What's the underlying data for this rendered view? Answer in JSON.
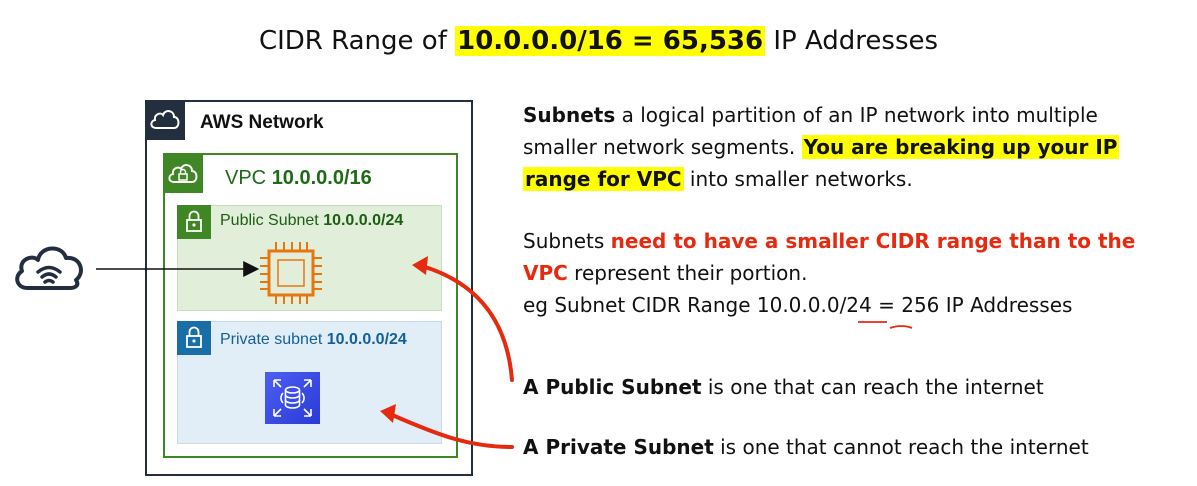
{
  "title": {
    "prefix": "CIDR Range of ",
    "highlight": "10.0.0.0/16 = 65,536",
    "suffix": " IP Addresses"
  },
  "diagram": {
    "aws_network_label": "AWS Network",
    "vpc_label_prefix": "VPC ",
    "vpc_cidr": "10.0.0.0/16",
    "public_subnet_label": "Public Subnet ",
    "public_subnet_cidr": "10.0.0.0/24",
    "private_subnet_label": "Private subnet ",
    "private_subnet_cidr": "10.0.0.0/24",
    "icons": [
      "internet-cloud-icon",
      "aws-cloud-icon",
      "vpc-cloud-lock-icon",
      "public-subnet-lock-icon",
      "ec2-chip-icon",
      "private-subnet-lock-icon",
      "rds-database-icon"
    ]
  },
  "description": {
    "p1_term": "Subnets",
    "p1_line1_rest": " a logical partition of an IP network into multiple",
    "p1_line2_plain": "smaller network segments. ",
    "p1_line2_highlight": "You are breaking up your IP",
    "p1_line3_highlight": "range for VPC",
    "p1_line3_rest": " into smaller networks.",
    "p2_line1_plain": "Subnets ",
    "p2_line1_red": "need to have a smaller CIDR range than to the",
    "p2_line2_red": "VPC",
    "p2_line2_rest": " represent their portion.",
    "p2_line3": "eg  Subnet CIDR Range 10.0.0.0/24 = 256 IP Addresses",
    "public_term": "A Public Subnet",
    "public_rest": " is one that can reach the internet",
    "private_term": "A Private Subnet",
    "private_rest": " is one that cannot reach the internet"
  },
  "colors": {
    "highlight": "#ffff00",
    "annotation_red": "#e62a0f",
    "aws_dark": "#232f3e",
    "vpc_green": "#3f8624",
    "private_blue": "#1a6ea8",
    "ec2_orange": "#e7760d"
  }
}
